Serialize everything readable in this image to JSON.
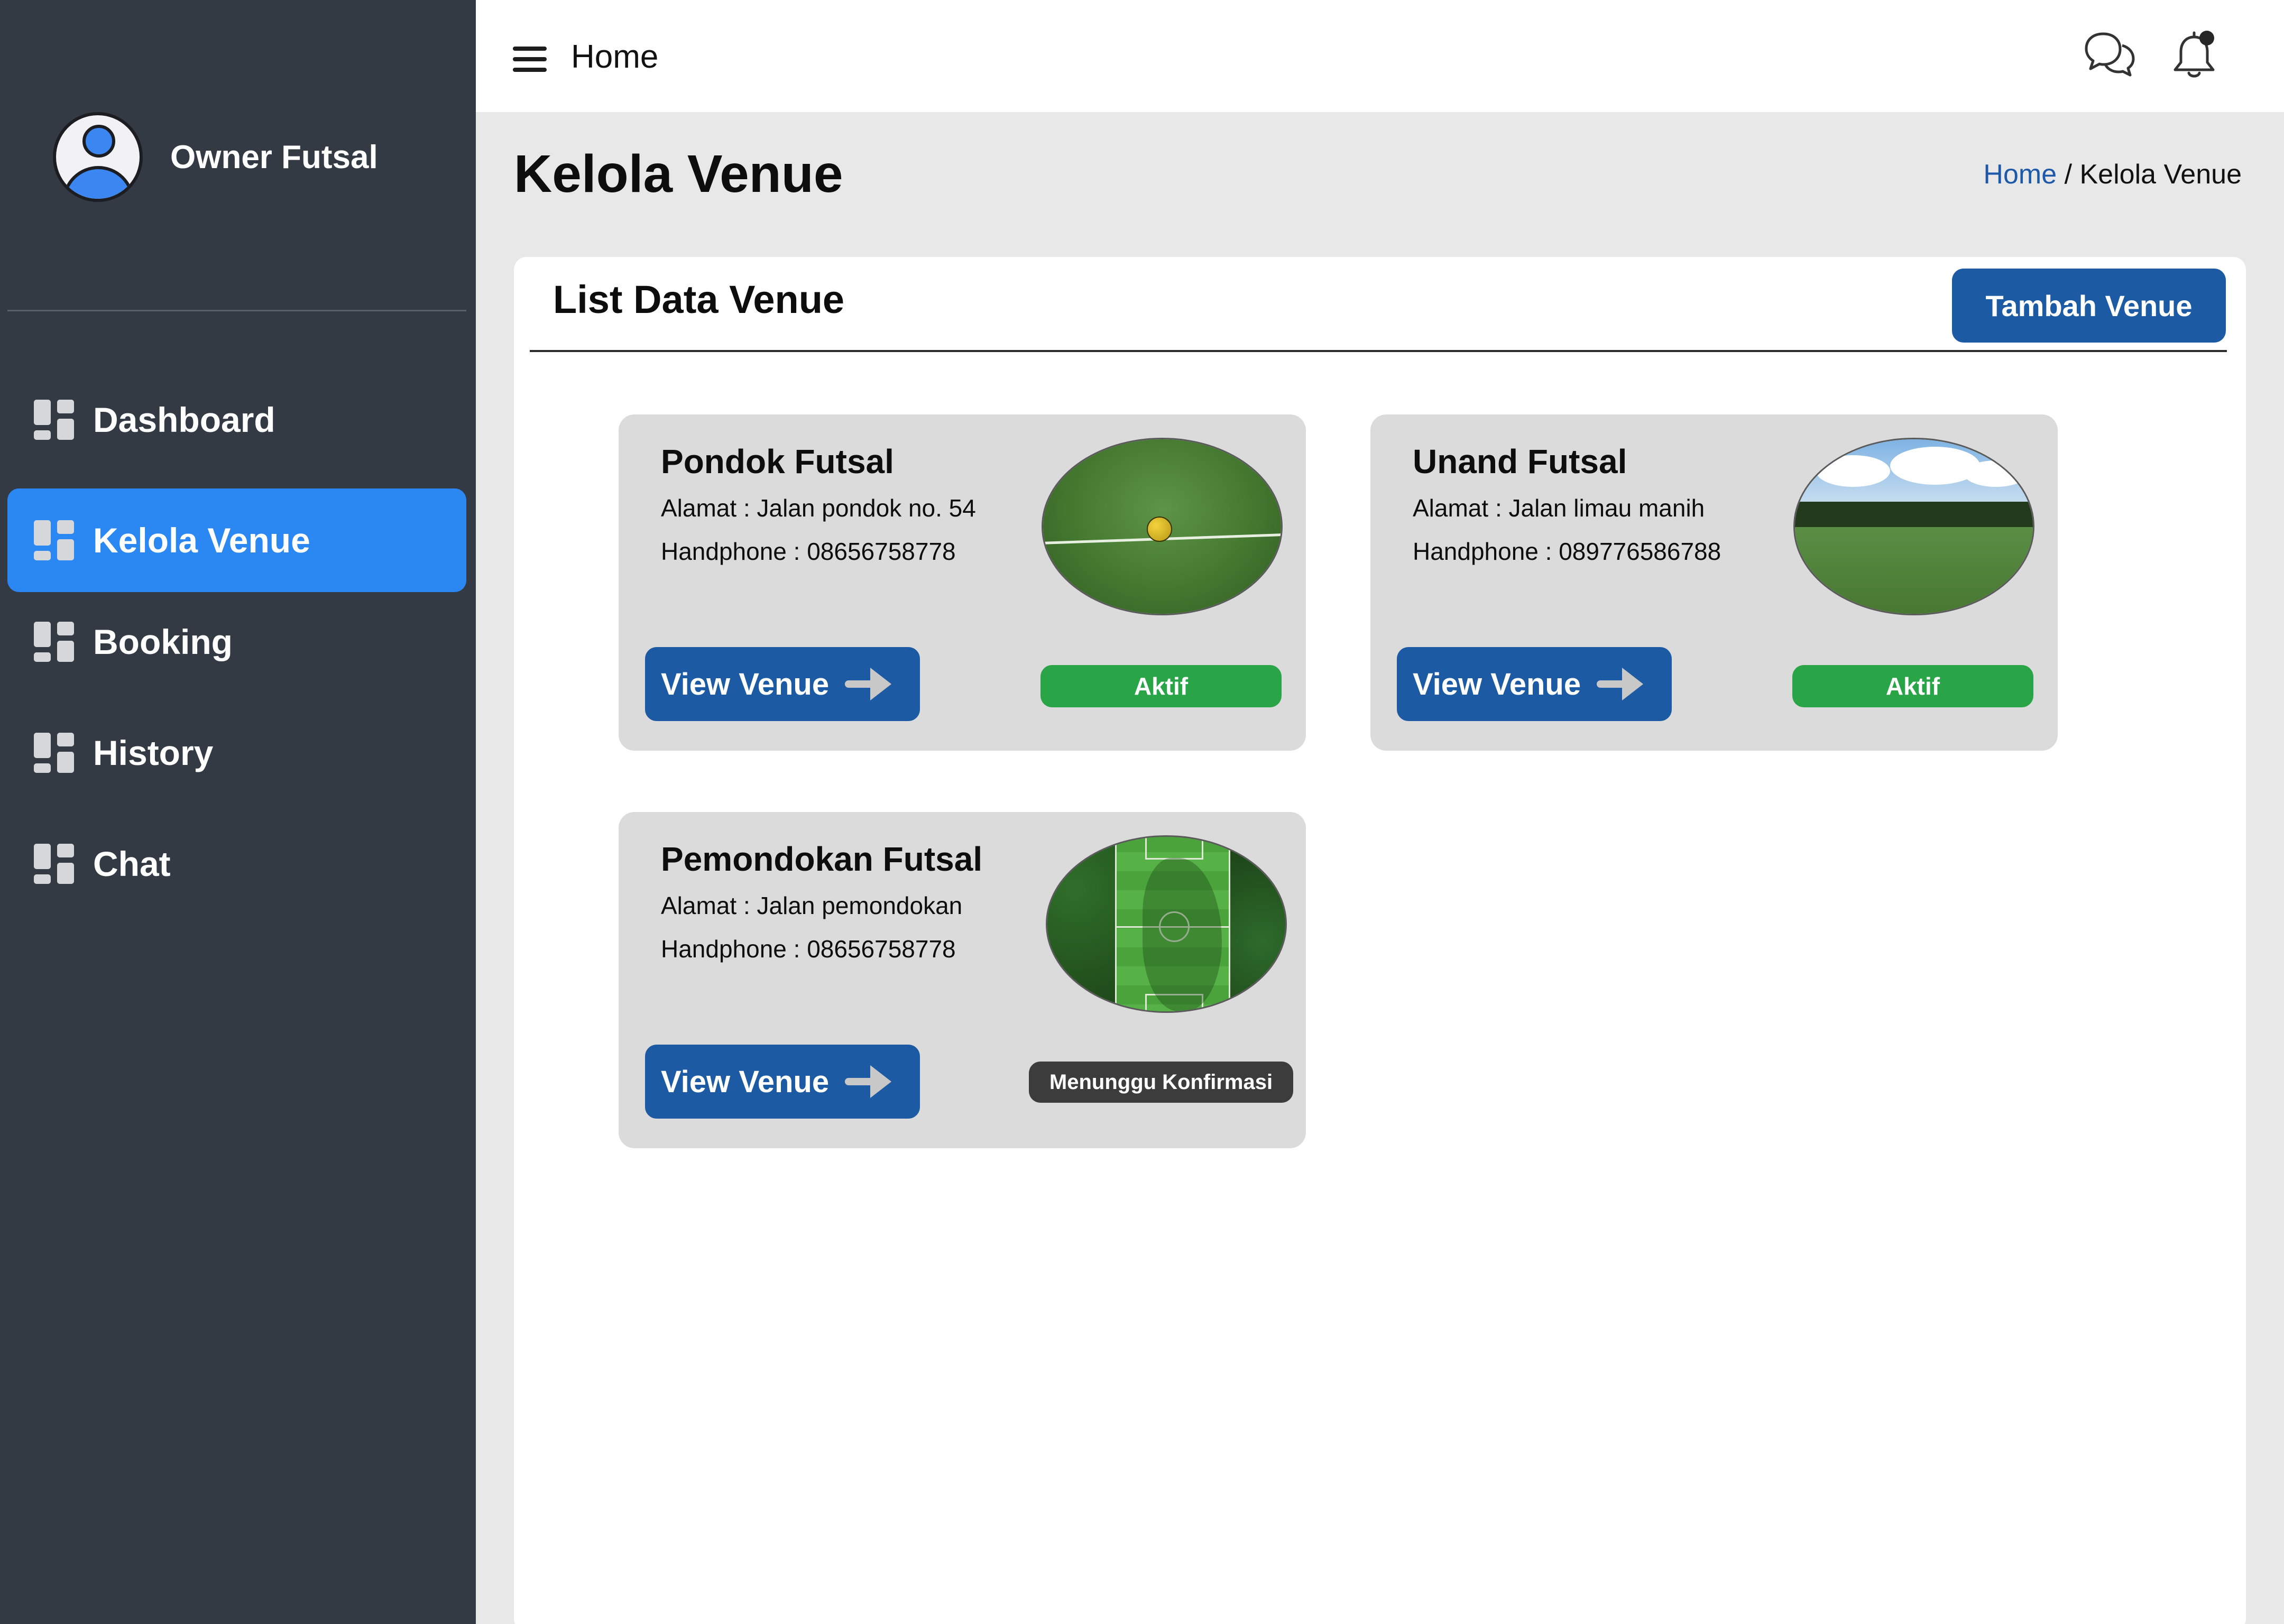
{
  "sidebar": {
    "profile_name": "Owner Futsal",
    "items": [
      {
        "label": "Dashboard",
        "icon": "dashboard-icon"
      },
      {
        "label": "Kelola Venue",
        "icon": "dashboard-icon",
        "active": true
      },
      {
        "label": "Booking",
        "icon": "dashboard-icon"
      },
      {
        "label": "History",
        "icon": "dashboard-icon"
      },
      {
        "label": "Chat",
        "icon": "dashboard-icon"
      }
    ]
  },
  "header": {
    "title": "Home",
    "icons": [
      "menu-icon",
      "chat-icon",
      "notification-bell-icon"
    ]
  },
  "page": {
    "title": "Kelola Venue",
    "breadcrumb": {
      "home": "Home",
      "separator": "/",
      "current": "Kelola Venue"
    }
  },
  "panel": {
    "title": "List Data Venue",
    "add_button": "Tambah Venue"
  },
  "venues": [
    {
      "name": "Pondok Futsal",
      "address": "Alamat : Jalan pondok no. 54",
      "phone": "Handphone : 08656758778",
      "button": "View Venue",
      "status": "Aktif"
    },
    {
      "name": "Unand Futsal",
      "address": "Alamat : Jalan limau manih",
      "phone": "Handphone : 089776586788",
      "button": "View Venue",
      "status": "Aktif"
    },
    {
      "name": "Pemondokan Futsal",
      "address": "Alamat : Jalan pemondokan",
      "phone": "Handphone : 08656758778",
      "button": "View Venue",
      "status": "Menunggu Konfirmasi"
    }
  ],
  "colors": {
    "sidebar_bg": "#343a43",
    "active_nav": "#2b88f3",
    "primary_button": "#1c5aa3",
    "status_active": "#29a447",
    "status_pending": "#3c3c3c",
    "breadcrumb_link": "#1d59a8"
  }
}
